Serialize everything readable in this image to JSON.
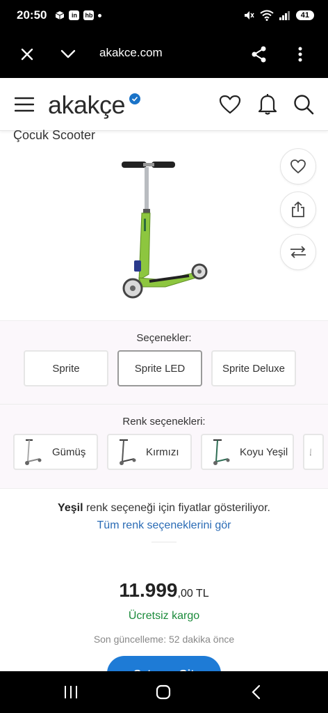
{
  "status_bar": {
    "time": "20:50",
    "badge1": "in",
    "badge2": "hb",
    "battery": "41"
  },
  "browser": {
    "url": "akakce.com"
  },
  "header": {
    "logo": "akakçe"
  },
  "product": {
    "title": "Çocuk Scooter"
  },
  "options": {
    "label": "Seçenekler:",
    "items": [
      {
        "label": "Sprite"
      },
      {
        "label": "Sprite LED",
        "selected": true
      },
      {
        "label": "Sprite Deluxe"
      }
    ]
  },
  "colors": {
    "label": "Renk seçenekleri:",
    "items": [
      {
        "label": "Gümüş"
      },
      {
        "label": "Kırmızı"
      },
      {
        "label": "Koyu Yeşil"
      }
    ]
  },
  "price_info": {
    "highlight": "Yeşil",
    "text": " renk seçeneği için fiyatlar gösteriliyor.",
    "link": "Tüm renk seçeneklerini gör"
  },
  "price": {
    "main": "11.999",
    "fraction": ",00 TL",
    "shipping": "Ücretsiz kargo",
    "updated": "Son güncelleme: 52 dakika önce",
    "cta_label": "Satıcıya Git"
  },
  "colors_theme": {
    "accent": "#1e7bd6",
    "free_shipping": "#1a8a3a",
    "link": "#2a6bb5"
  }
}
